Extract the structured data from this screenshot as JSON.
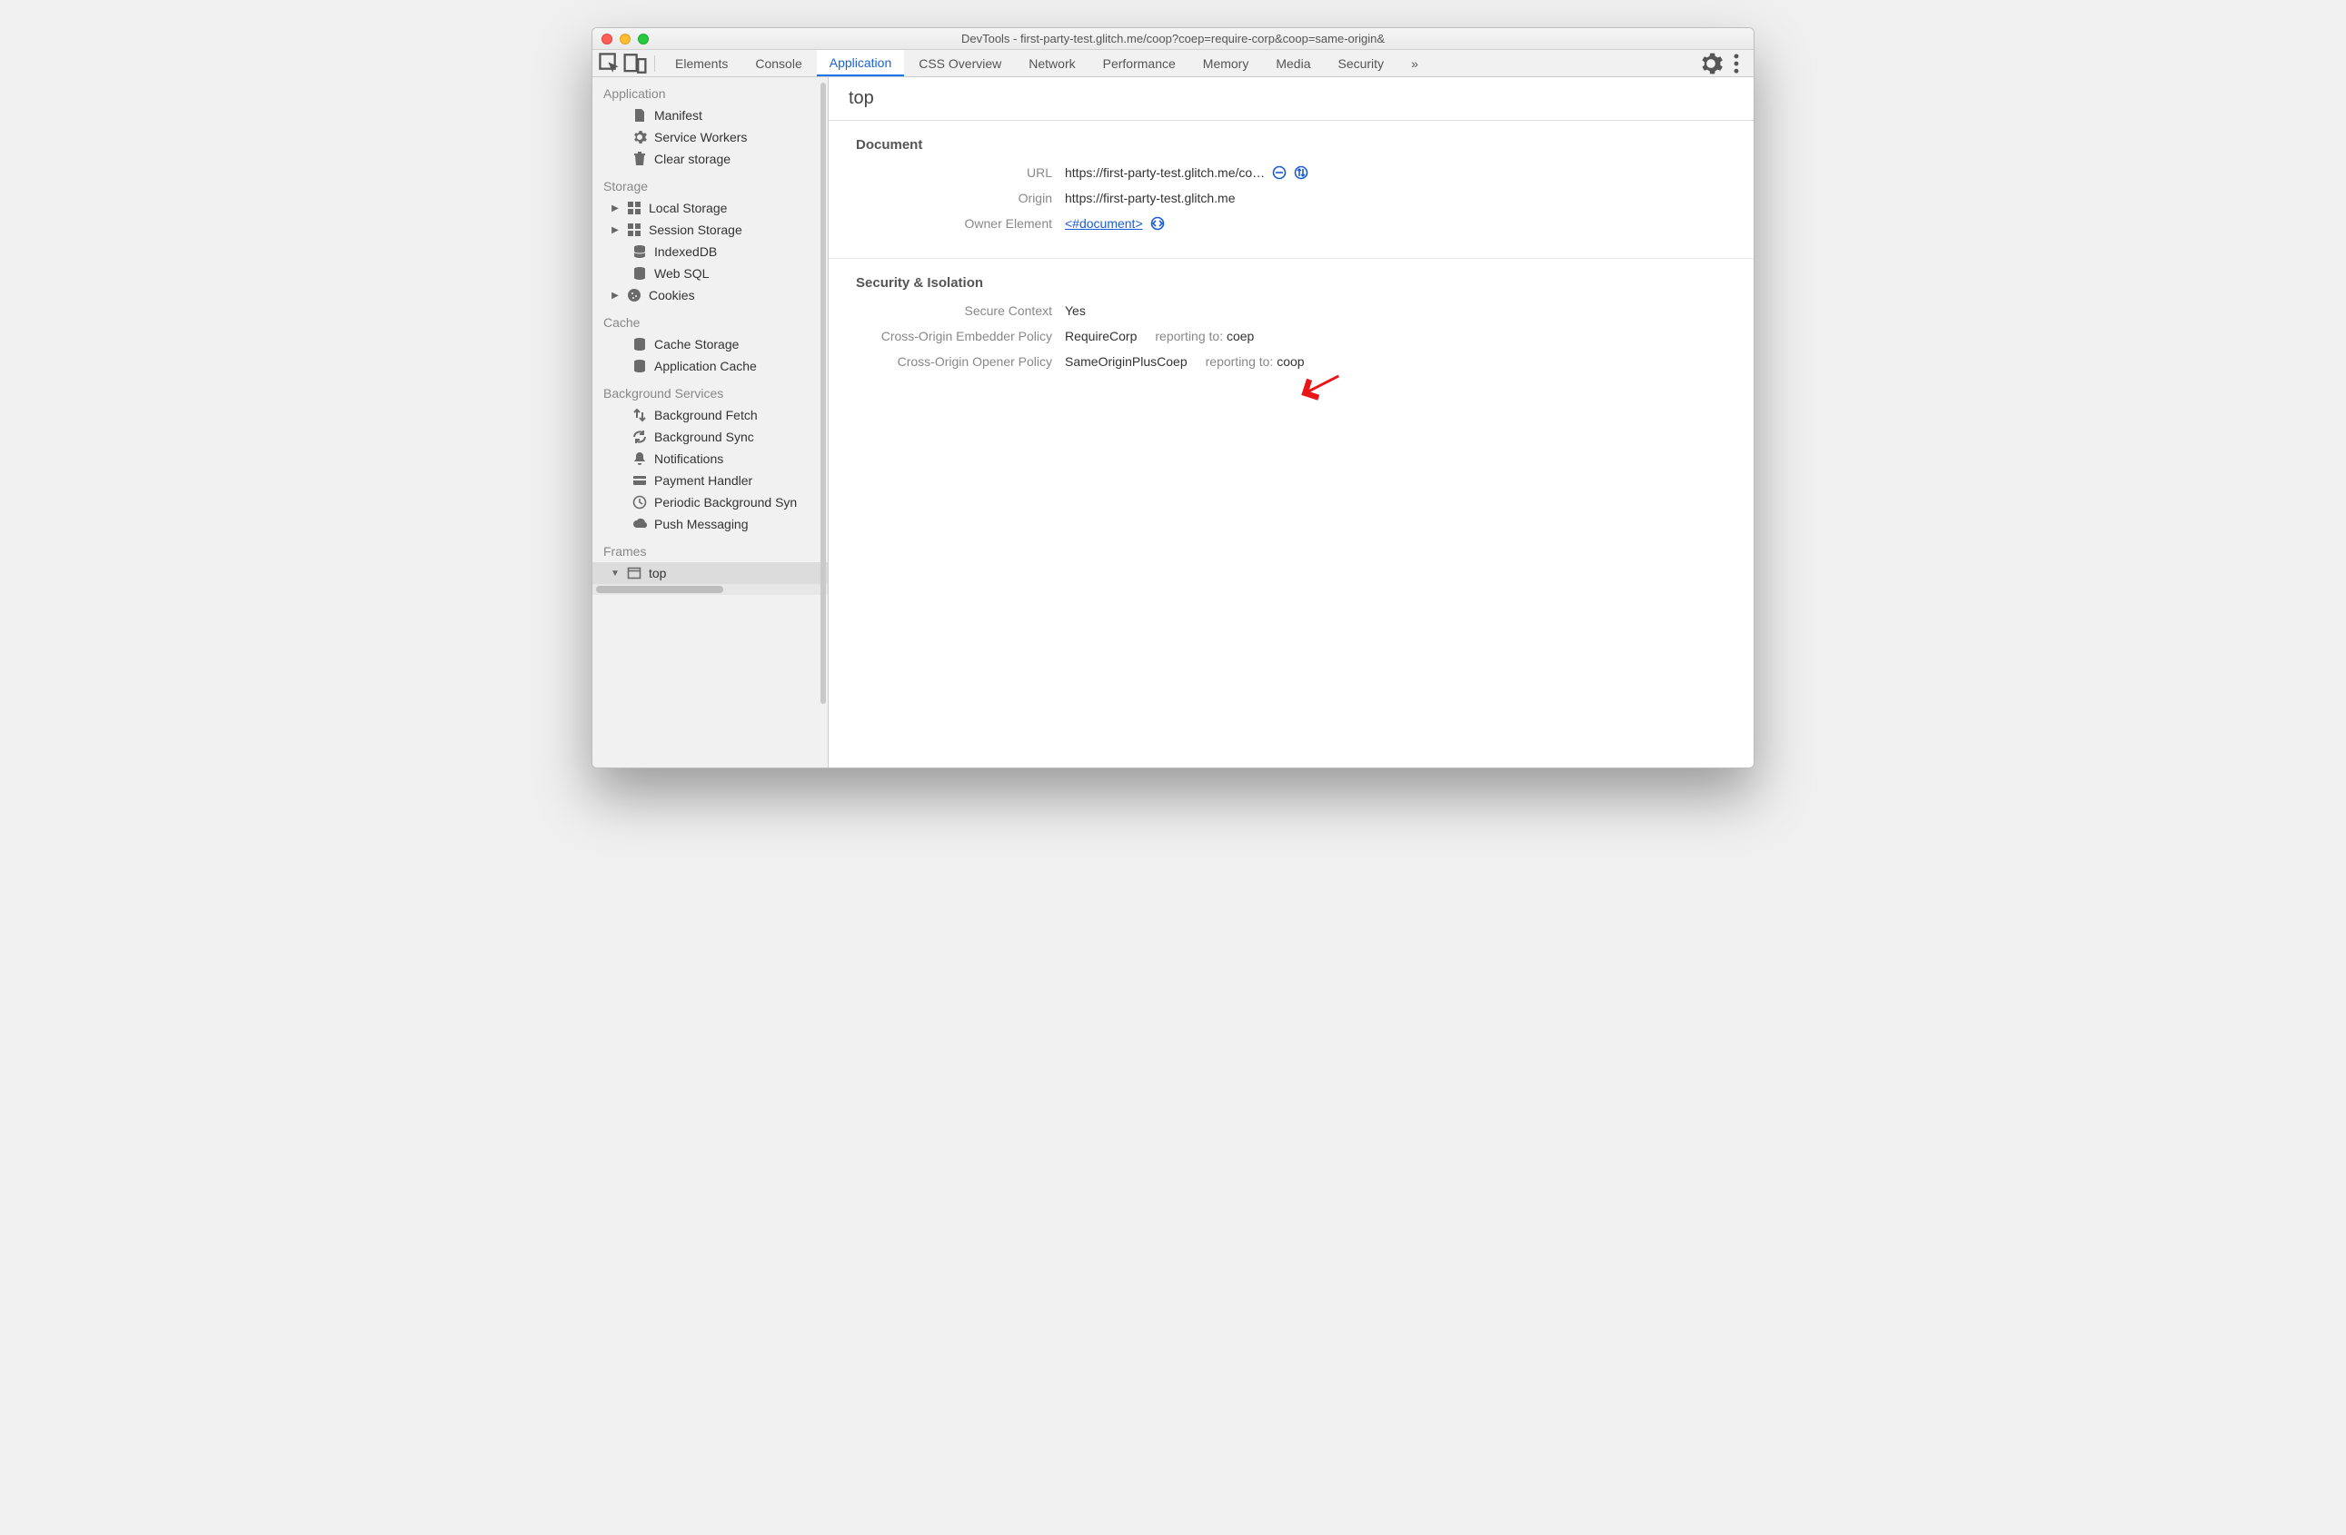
{
  "window": {
    "title": "DevTools - first-party-test.glitch.me/coop?coep=require-corp&coop=same-origin&"
  },
  "tabs": {
    "items": [
      "Elements",
      "Console",
      "Application",
      "CSS Overview",
      "Network",
      "Performance",
      "Memory",
      "Media",
      "Security"
    ],
    "active": "Application",
    "overflow_glyph": "»"
  },
  "sidebar": {
    "sections": [
      {
        "title": "Application",
        "items": [
          {
            "icon": "file",
            "label": "Manifest"
          },
          {
            "icon": "gear",
            "label": "Service Workers"
          },
          {
            "icon": "trash",
            "label": "Clear storage"
          }
        ]
      },
      {
        "title": "Storage",
        "items": [
          {
            "icon": "grid",
            "label": "Local Storage",
            "expandable": true
          },
          {
            "icon": "grid",
            "label": "Session Storage",
            "expandable": true
          },
          {
            "icon": "db",
            "label": "IndexedDB"
          },
          {
            "icon": "db",
            "label": "Web SQL"
          },
          {
            "icon": "cookie",
            "label": "Cookies",
            "expandable": true
          }
        ]
      },
      {
        "title": "Cache",
        "items": [
          {
            "icon": "db",
            "label": "Cache Storage"
          },
          {
            "icon": "db",
            "label": "Application Cache"
          }
        ]
      },
      {
        "title": "Background Services",
        "items": [
          {
            "icon": "updown",
            "label": "Background Fetch"
          },
          {
            "icon": "sync",
            "label": "Background Sync"
          },
          {
            "icon": "bell",
            "label": "Notifications"
          },
          {
            "icon": "card",
            "label": "Payment Handler"
          },
          {
            "icon": "clock",
            "label": "Periodic Background Syn"
          },
          {
            "icon": "cloud",
            "label": "Push Messaging"
          }
        ]
      },
      {
        "title": "Frames",
        "items": [
          {
            "icon": "frame",
            "label": "top",
            "expandable": true,
            "expanded": true,
            "selected": true
          }
        ]
      }
    ]
  },
  "detail": {
    "title": "top",
    "document": {
      "heading": "Document",
      "url_label": "URL",
      "url_value": "https://first-party-test.glitch.me/co…",
      "origin_label": "Origin",
      "origin_value": "https://first-party-test.glitch.me",
      "owner_label": "Owner Element",
      "owner_link": "<#document>"
    },
    "security": {
      "heading": "Security & Isolation",
      "secure_context_label": "Secure Context",
      "secure_context_value": "Yes",
      "coep_label": "Cross-Origin Embedder Policy",
      "coep_value": "RequireCorp",
      "coep_reporting_label": "reporting to:",
      "coep_reporting_value": "coep",
      "coop_label": "Cross-Origin Opener Policy",
      "coop_value": "SameOriginPlusCoep",
      "coop_reporting_label": "reporting to:",
      "coop_reporting_value": "coop"
    }
  },
  "colors": {
    "accent": "#1a73e8",
    "link": "#1a5cd6",
    "annotation": "#e81616"
  }
}
